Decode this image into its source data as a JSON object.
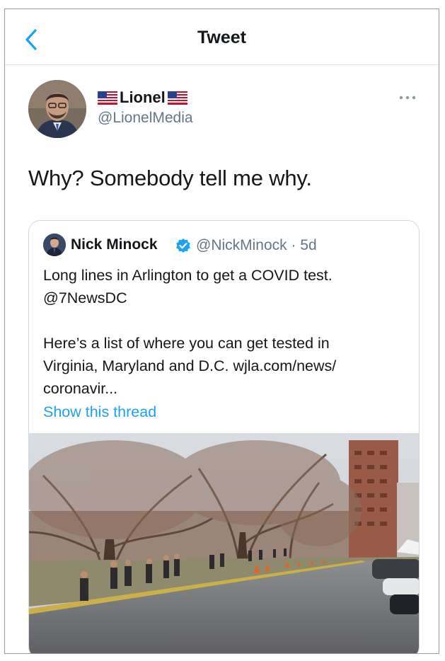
{
  "header": {
    "title": "Tweet",
    "back_icon": "chevron-left-icon"
  },
  "tweet": {
    "display_name": "Lionel",
    "name_flags": [
      "us-flag-icon",
      "us-flag-icon"
    ],
    "handle": "@LionelMedia",
    "text": "Why? Somebody tell me why.",
    "more_icon": "more-dots-icon"
  },
  "quoted_tweet": {
    "display_name": "Nick Minock",
    "verified": true,
    "handle_time": "@NickMinock · 5d",
    "lines": [
      "Long lines in Arlington to get a COVID test.",
      "@7NewsDC",
      "Here’s a list of where you can get tested in",
      "Virginia, Maryland and D.C. wjla.com/news/",
      "coronavir..."
    ],
    "show_thread": "Show this thread"
  },
  "colors": {
    "accent": "#1da1f2",
    "text": "#14171a",
    "muted": "#657786",
    "border": "#e1e8ed"
  }
}
